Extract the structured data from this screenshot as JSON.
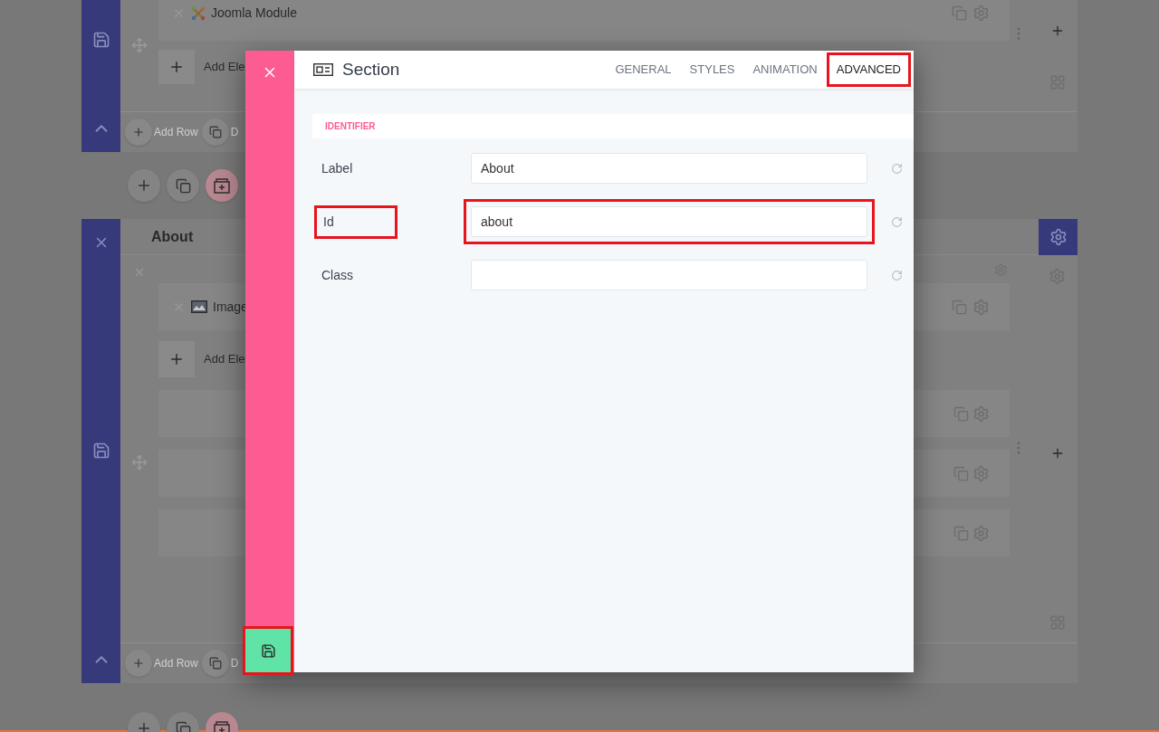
{
  "top_section": {
    "element": "Joomla Module",
    "add_element": "Add Ele",
    "add_row": "Add Row",
    "row_action": "D"
  },
  "about_section": {
    "title": "About",
    "element": "Image",
    "add_element": "Add Ele",
    "add_row": "Add Row",
    "row_action": "D"
  },
  "modal": {
    "title": "Section",
    "tabs": [
      {
        "label": "GENERAL",
        "selected": false,
        "highlighted": false
      },
      {
        "label": "STYLES",
        "selected": false,
        "highlighted": false
      },
      {
        "label": "ANIMATION",
        "selected": false,
        "highlighted": false
      },
      {
        "label": "ADVANCED",
        "selected": true,
        "highlighted": true
      }
    ],
    "group": "IDENTIFIER",
    "fields": [
      {
        "label": "Label",
        "value": "About",
        "label_highlighted": false,
        "field_highlighted": false
      },
      {
        "label": "Id",
        "value": "about",
        "label_highlighted": true,
        "field_highlighted": true
      },
      {
        "label": "Class",
        "label_highlighted": false,
        "field_highlighted": false
      }
    ],
    "save_highlighted": true
  }
}
